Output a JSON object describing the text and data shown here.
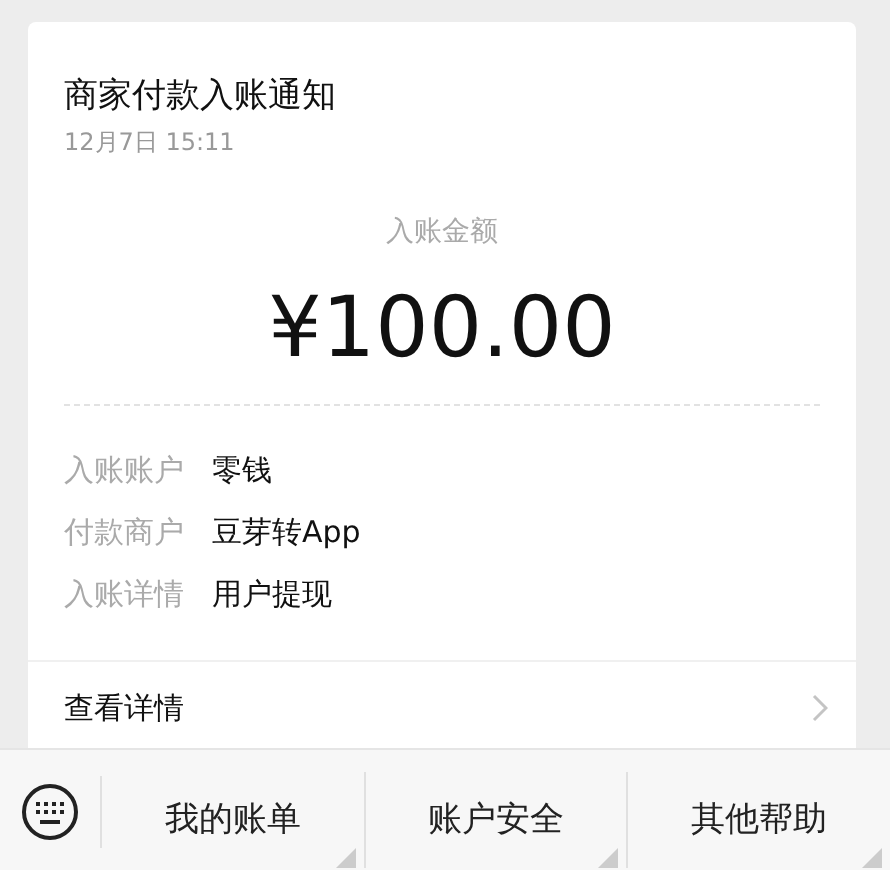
{
  "card": {
    "title": "商家付款入账通知",
    "time": "12月7日  15:11",
    "amount_label": "入账金额",
    "amount": "¥100.00",
    "details": [
      {
        "label": "入账账户",
        "value": "零钱"
      },
      {
        "label": "付款商户",
        "value": "豆芽转App"
      },
      {
        "label": "入账详情",
        "value": "用户提现"
      }
    ],
    "link": "查看详情"
  },
  "menu": [
    "我的账单",
    "账户安全",
    "其他帮助"
  ]
}
